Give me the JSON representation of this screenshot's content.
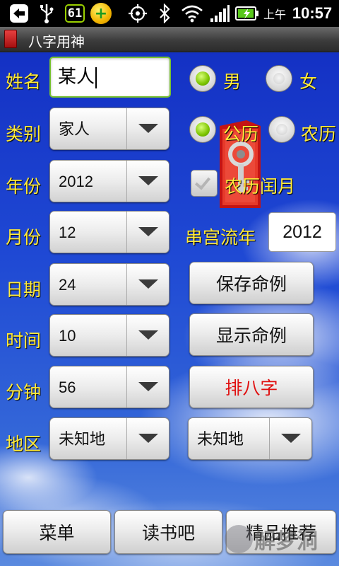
{
  "status_bar": {
    "badge": "61",
    "am_pm": "上午",
    "time": "10:57"
  },
  "title_bar": {
    "title": "八字用神"
  },
  "form": {
    "name_label": "姓名",
    "name_value": "某人",
    "gender_male": "男",
    "gender_female": "女",
    "category_label": "类别",
    "category_value": "家人",
    "calendar_solar": "公历",
    "calendar_lunar": "农历",
    "year_label": "年份",
    "year_value": "2012",
    "leap_month_label": "农历闰月",
    "month_label": "月份",
    "month_value": "12",
    "flow_year_label": "串宫流年",
    "flow_year_value": "2012",
    "day_label": "日期",
    "day_value": "24",
    "hour_label": "时间",
    "hour_value": "10",
    "minute_label": "分钟",
    "minute_value": "56",
    "region_label": "地区",
    "region_value": "未知地",
    "region2_value": "未知地"
  },
  "buttons": {
    "save": "保存命例",
    "show": "显示命例",
    "paipan": "排八字"
  },
  "bottom_bar": {
    "menu": "菜单",
    "read": "读书吧",
    "recommend": "精品推荐"
  },
  "watermark": "解梦洞",
  "colors": {
    "label_yellow": "#ffea3a",
    "paipan_red": "#e01010",
    "radio_green": "#7cc400",
    "background_blue": "#1f49d4"
  },
  "icons": [
    "back-icon",
    "usb-icon",
    "gps-icon",
    "bluetooth-icon",
    "wifi-icon",
    "signal-icon",
    "battery-icon",
    "folder-key-icon"
  ]
}
